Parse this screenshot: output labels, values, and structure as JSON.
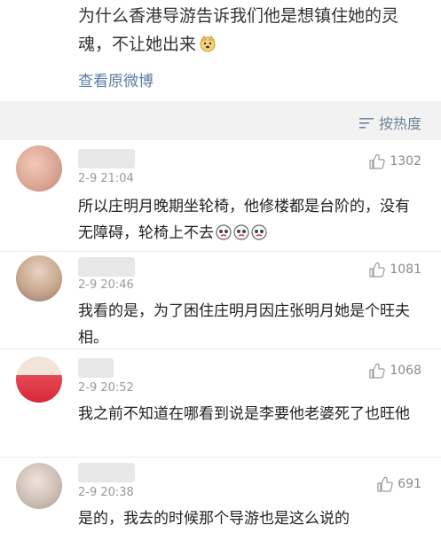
{
  "post": {
    "text": "为什么香港导游告诉我们他是想镇住她的灵魂，不让她出来",
    "view_original": "查看原微博"
  },
  "sort": {
    "label": "按热度"
  },
  "comments": [
    {
      "time": "2-9 21:04",
      "likes": "1302",
      "text": "所以庄明月晚期坐轮椅，他修楼都是台阶的，没有无障碍，轮椅上不去"
    },
    {
      "time": "2-9 20:46",
      "likes": "1081",
      "text": "我看的是，为了困住庄明月因庄张明月她是个旺夫相。"
    },
    {
      "time": "2-9 20:52",
      "likes": "1068",
      "text": "我之前不知道在哪看到说是李要他老婆死了也旺他"
    },
    {
      "time": "2-9 20:38",
      "likes": "691",
      "text": "是的，我去的时候那个导游也是这么说的"
    }
  ],
  "icons": {
    "like": "thumbs-up-icon",
    "sort": "sort-lines-icon",
    "inline_emoji": "dog-face-emoji",
    "comment_emoji": "crying-face-emoji"
  },
  "colors": {
    "link": "#5b7ca3",
    "meta": "#999999",
    "background": "#f2f2f2",
    "card": "#ffffff"
  }
}
